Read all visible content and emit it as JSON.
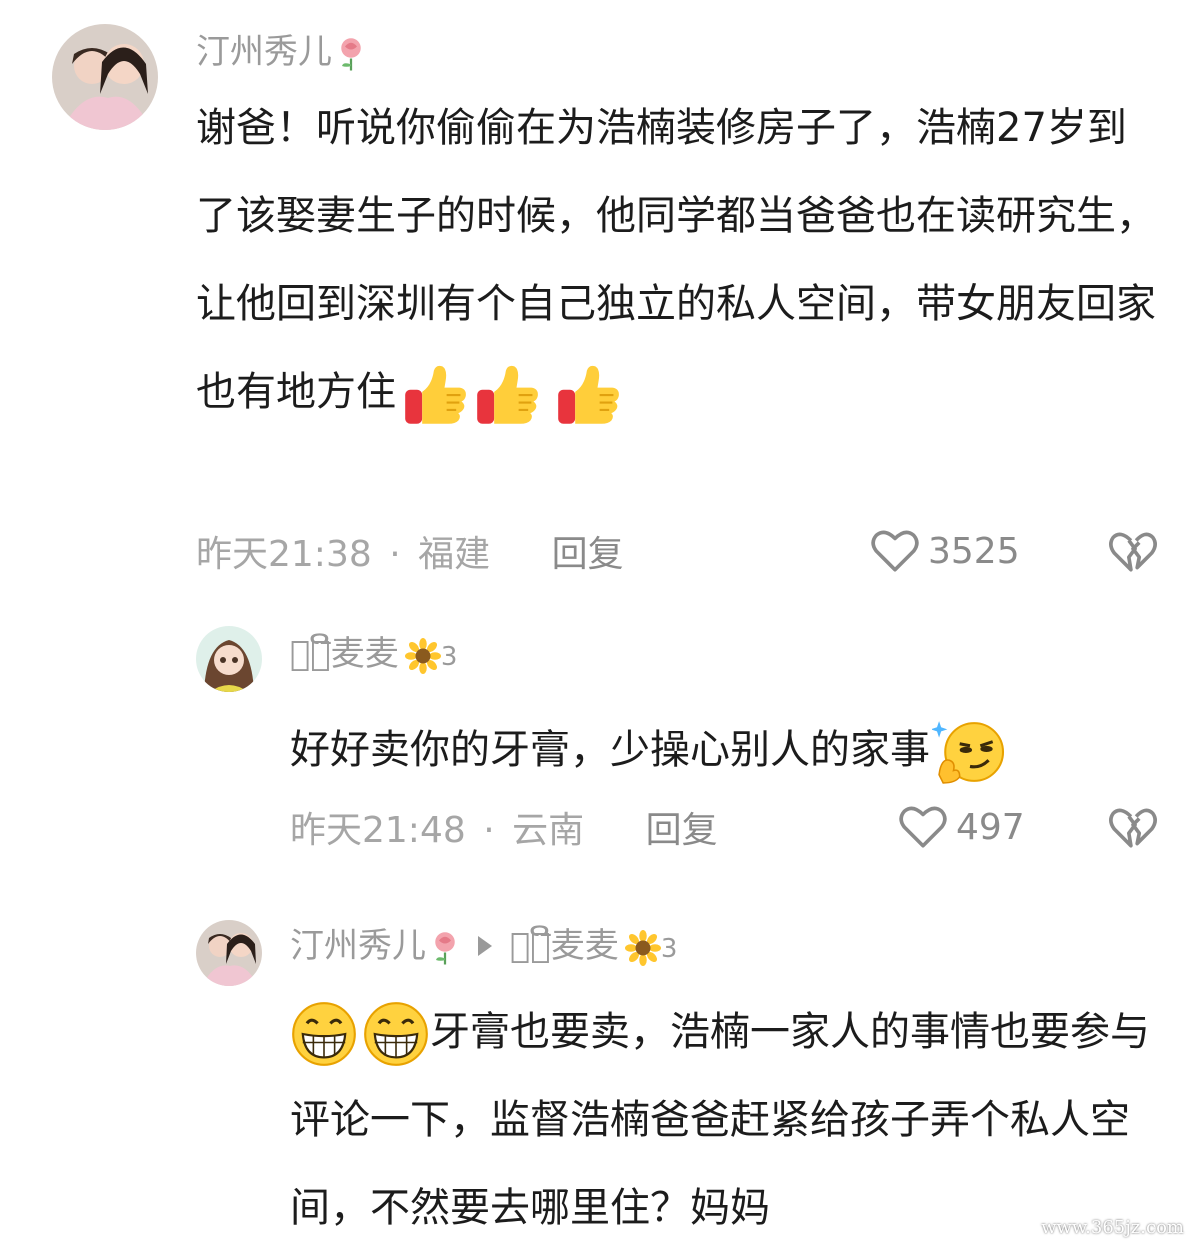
{
  "comments": [
    {
      "username": "汀州秀儿",
      "username_icon": "rose-icon",
      "text": "谢爸！听说你偷偷在为浩楠装修房子了，浩楠27岁到了该娶妻生子的时候，他同学都当爸爸也在读研究生，让他回到深圳有个自己独立的私人空间，带女朋友回家也有地方住",
      "emojis": [
        "thumbs-up-icon",
        "thumbs-up-icon",
        "thumbs-up-icon"
      ],
      "time": "昨天21:38",
      "separator": "·",
      "location": "福建",
      "reply_label": "回复",
      "likes": "3525"
    },
    {
      "username": "ꩻ᪵ີ麦麦",
      "username_icon": "sunflower-icon",
      "username_suffix": "3",
      "text": "好好卖你的牙膏，少操心别人的家事",
      "emojis": [
        "smirk-icon"
      ],
      "time": "昨天21:48",
      "separator": "·",
      "location": "云南",
      "reply_label": "回复",
      "likes": "497"
    },
    {
      "username": "汀州秀儿",
      "username_icon": "rose-icon",
      "reply_to": "ꩻ᪵ີ麦麦",
      "reply_to_icon": "sunflower-icon",
      "reply_to_suffix": "3",
      "emojis": [
        "grin-icon",
        "grin-icon"
      ],
      "text": "牙膏也要卖，浩楠一家人的事情也要参与评论一下，监督浩楠爸爸赶紧给孩子弄个私人空间，不然要去哪里住？妈妈"
    }
  ],
  "watermark": "www.365jz.com",
  "colors": {
    "meta": "#a6a6a6",
    "name": "#9a9a9a",
    "text": "#1c1c1c"
  }
}
